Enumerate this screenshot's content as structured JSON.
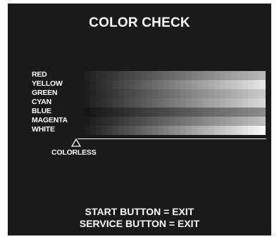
{
  "screen": {
    "title": "COLOR CHECK",
    "colors": [
      {
        "label": "RED",
        "start_shade": "#222222",
        "end_shade": "#b8b8b8"
      },
      {
        "label": "YELLOW",
        "start_shade": "#1f1f1f",
        "end_shade": "#e4e4e4"
      },
      {
        "label": "GREEN",
        "start_shade": "#1f1f1f",
        "end_shade": "#c8c8c8"
      },
      {
        "label": "CYAN",
        "start_shade": "#1f1f1f",
        "end_shade": "#d6d6d6"
      },
      {
        "label": "BLUE",
        "start_shade": "#161616",
        "end_shade": "#8a8a8a"
      },
      {
        "label": "MAGENTA",
        "start_shade": "#1c1c1c",
        "end_shade": "#bdbdbd"
      },
      {
        "label": "WHITE",
        "start_shade": "#1f1f1f",
        "end_shade": "#f6f6f6"
      }
    ],
    "steps": 32,
    "colorless_label": "COLORLESS",
    "footer": {
      "line1": "START BUTTON = EXIT",
      "line2": "SERVICE BUTTON = EXIT"
    },
    "theme": {
      "background": "#1a1a1a",
      "text": "#ffffff"
    }
  }
}
